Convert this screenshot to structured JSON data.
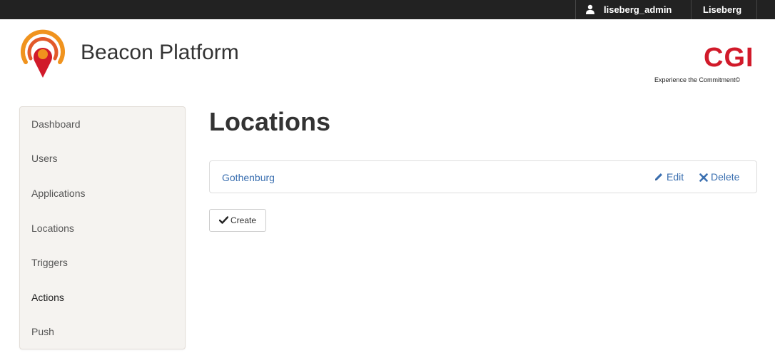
{
  "topbar": {
    "user_name": "liseberg_admin",
    "org_name": "Liseberg"
  },
  "brand": {
    "title": "Beacon Platform",
    "partner_logo": "CGI",
    "partner_tagline": "Experience the Commitment©"
  },
  "sidebar": {
    "items": [
      {
        "label": "Dashboard"
      },
      {
        "label": "Users"
      },
      {
        "label": "Applications"
      },
      {
        "label": "Locations"
      },
      {
        "label": "Triggers"
      },
      {
        "label": "Actions"
      },
      {
        "label": "Push"
      }
    ],
    "active": "Actions"
  },
  "main": {
    "title": "Locations",
    "locations": [
      {
        "name": "Gothenburg",
        "edit_label": "Edit",
        "delete_label": "Delete"
      }
    ],
    "create_label": "Create"
  },
  "colors": {
    "topbar_bg": "#222222",
    "link": "#3a6fb0",
    "brand_orange": "#f0931e",
    "brand_red": "#d11a2a",
    "cgi_red": "#d11a2a"
  },
  "icons": {
    "user": "user-icon",
    "edit": "pencil-icon",
    "delete": "close-icon",
    "create": "check-icon",
    "logo": "beacon-logo-icon"
  }
}
